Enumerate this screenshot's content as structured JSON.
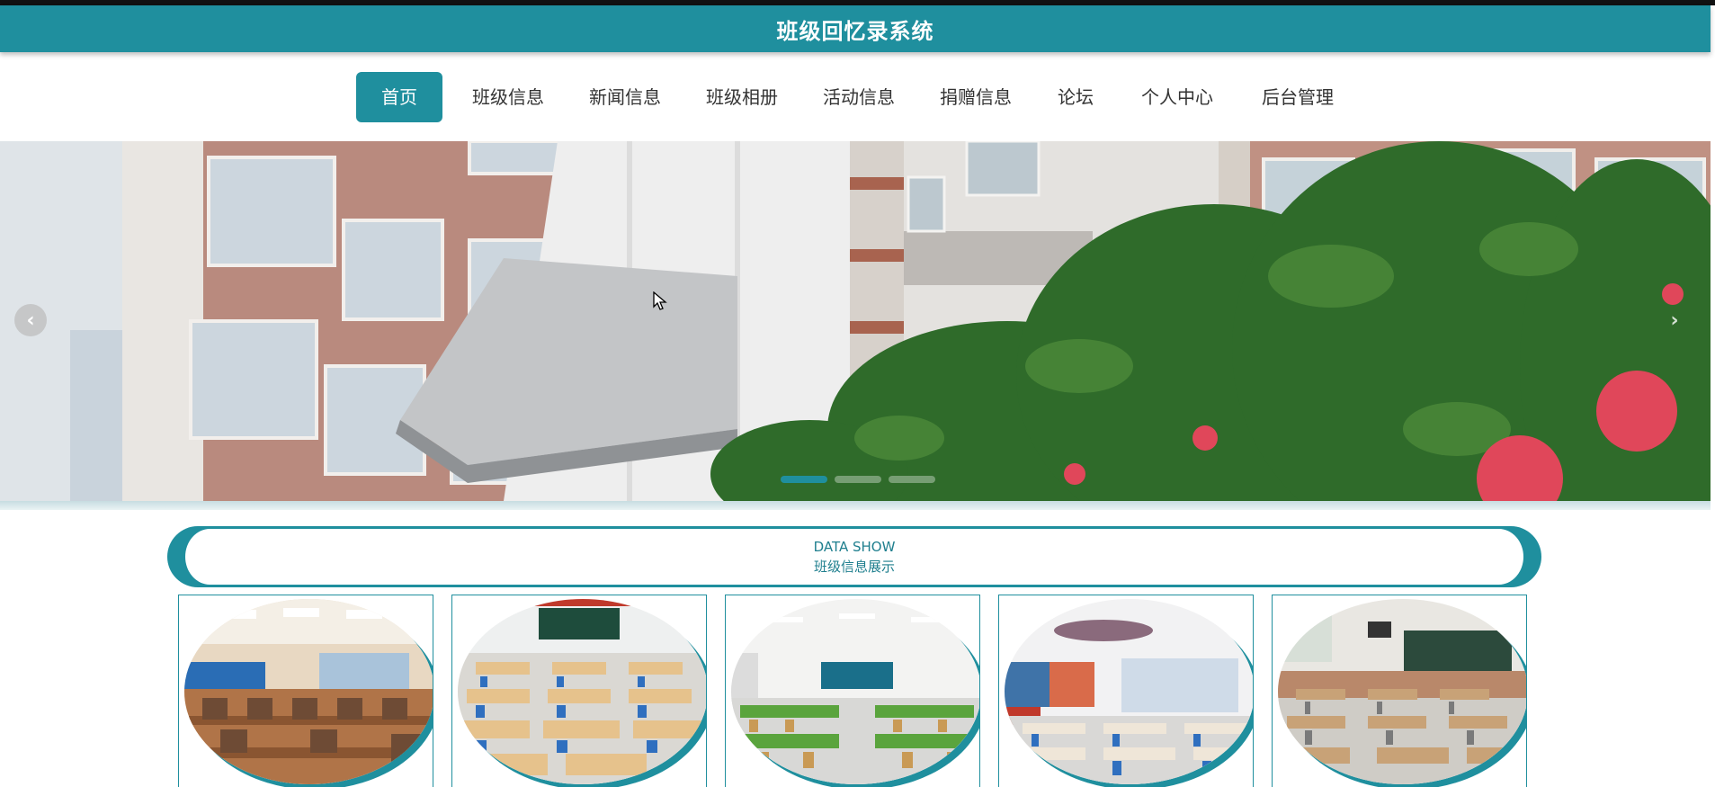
{
  "header": {
    "title": "班级回忆录系统"
  },
  "nav": {
    "items": [
      {
        "label": "首页",
        "active": true
      },
      {
        "label": "班级信息"
      },
      {
        "label": "新闻信息"
      },
      {
        "label": "班级相册"
      },
      {
        "label": "活动信息"
      },
      {
        "label": "捐赠信息"
      },
      {
        "label": "论坛"
      },
      {
        "label": "个人中心"
      },
      {
        "label": "后台管理"
      }
    ]
  },
  "carousel": {
    "prev_icon": "chevron-left-icon",
    "next_icon": "chevron-right-icon",
    "slide_count": 3,
    "active_slide": 1
  },
  "section": {
    "en_title": "DATA SHOW",
    "cn_title": "班级信息展示"
  },
  "cards": [
    {
      "image": "lecture-hall-classroom"
    },
    {
      "image": "classroom-rows-blue-chairs"
    },
    {
      "image": "bright-classroom-green-tables"
    },
    {
      "image": "geography-classroom-maps"
    },
    {
      "image": "classroom-with-blackboard"
    }
  ],
  "colors": {
    "accent": "#1f8f9e",
    "header_text": "#ffffff"
  }
}
